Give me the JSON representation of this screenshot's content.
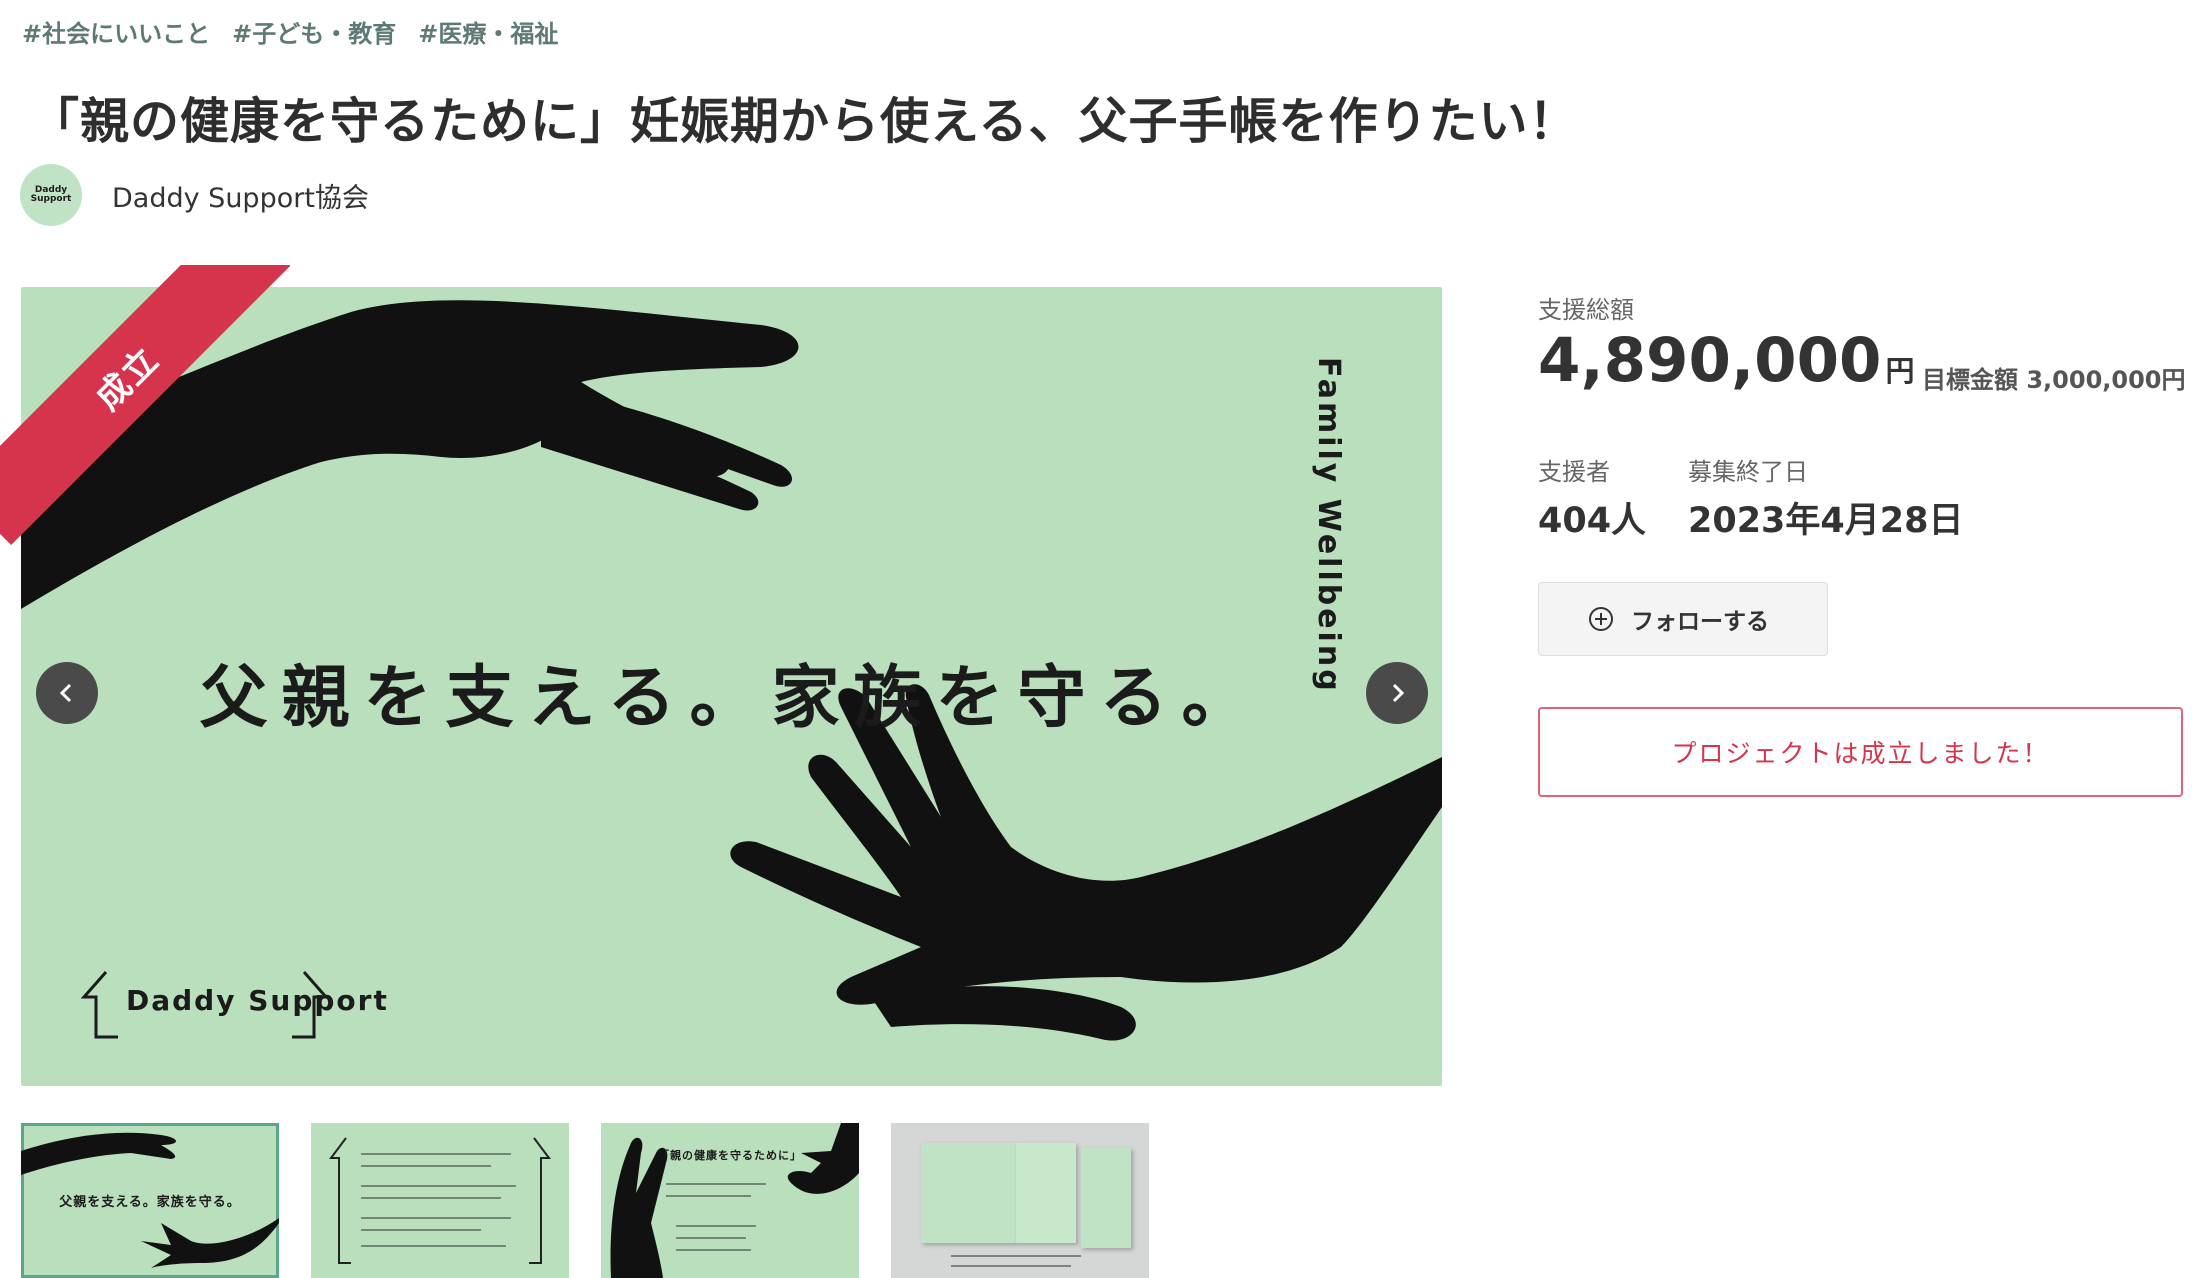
{
  "tags": [
    "#社会にいいこと",
    "#子ども・教育",
    "#医療・福祉"
  ],
  "title": "「親の健康を守るために」妊娠期から使える、父子手帳を作りたい！",
  "owner": {
    "avatar_icon": "daddy-support-logo-icon",
    "avatar_text": "Daddy Support",
    "name": "Daddy Support協会"
  },
  "hero": {
    "ribbon": "成立",
    "slogan": "父親を支える。家族を守る。",
    "vertical_text": "Family Wellbeing",
    "logo_text": "Daddy Support",
    "prev_icon": "chevron-left-icon",
    "next_icon": "chevron-right-icon"
  },
  "thumbnails": [
    {
      "caption": "父親を支える。家族を守る。"
    },
    {
      "caption": ""
    },
    {
      "caption": "「親の健康を守るために」"
    },
    {
      "caption": ""
    }
  ],
  "stats": {
    "total_label": "支援総額",
    "total_amount": "4,890,000",
    "total_unit": "円",
    "goal": "目標金額 3,000,000円",
    "supporters_label": "支援者",
    "supporters_value": "404人",
    "end_label": "募集終了日",
    "end_value": "2023年4月28日",
    "follow_label": "フォローする",
    "follow_icon": "plus-circle-icon",
    "success_message": "プロジェクトは成立しました！"
  },
  "colors": {
    "hero_green": "#b9dfbd",
    "ribbon_red": "#d6334d",
    "tag_color": "#5f7a76"
  }
}
